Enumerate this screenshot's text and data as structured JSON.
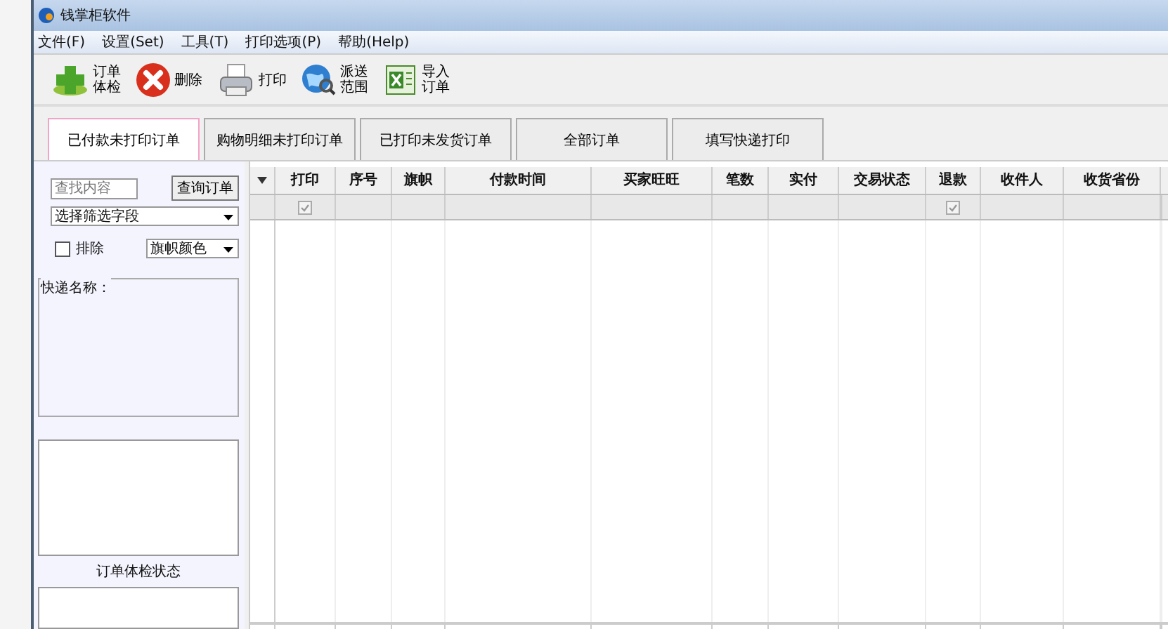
{
  "window": {
    "title": "钱掌柜软件"
  },
  "menu": [
    "文件(F)",
    "设置(Set)",
    "工具(T)",
    "打印选项(P)",
    "帮助(Help)"
  ],
  "toolbar": [
    {
      "kind": "add",
      "lines": [
        "订单",
        "体检"
      ]
    },
    {
      "kind": "delete",
      "lines": [
        "删除"
      ]
    },
    {
      "kind": "print",
      "lines": [
        "打印"
      ]
    },
    {
      "kind": "globe",
      "lines": [
        "派送",
        "范围"
      ]
    },
    {
      "kind": "excel",
      "lines": [
        "导入",
        "订单"
      ]
    }
  ],
  "tabs": [
    {
      "label": "已付款未打印订单",
      "selected": true
    },
    {
      "label": "购物明细未打印订单",
      "selected": false
    },
    {
      "label": "已打印未发货订单",
      "selected": false
    },
    {
      "label": "全部订单",
      "selected": false
    },
    {
      "label": "填写快递打印",
      "selected": false
    }
  ],
  "sidebar": {
    "search": {
      "placeholder": "查找内容"
    },
    "search_button": "查询订单",
    "field_select": "选择筛选字段",
    "exclude": {
      "label": "排除",
      "checked": false
    },
    "color_select": "旗帜颜色",
    "group_title": "快递名称：",
    "status_label": "订单体检状态"
  },
  "table": {
    "columns": [
      {
        "label": "打印",
        "filter": {
          "checked": true
        }
      },
      {
        "label": "序号"
      },
      {
        "label": "旗帜"
      },
      {
        "label": "付款时间"
      },
      {
        "label": "买家旺旺"
      },
      {
        "label": "笔数"
      },
      {
        "label": "实付"
      },
      {
        "label": "交易状态"
      },
      {
        "label": "退款",
        "filter": {
          "checked": true
        }
      },
      {
        "label": "收件人"
      },
      {
        "label": "收货省份"
      }
    ]
  }
}
